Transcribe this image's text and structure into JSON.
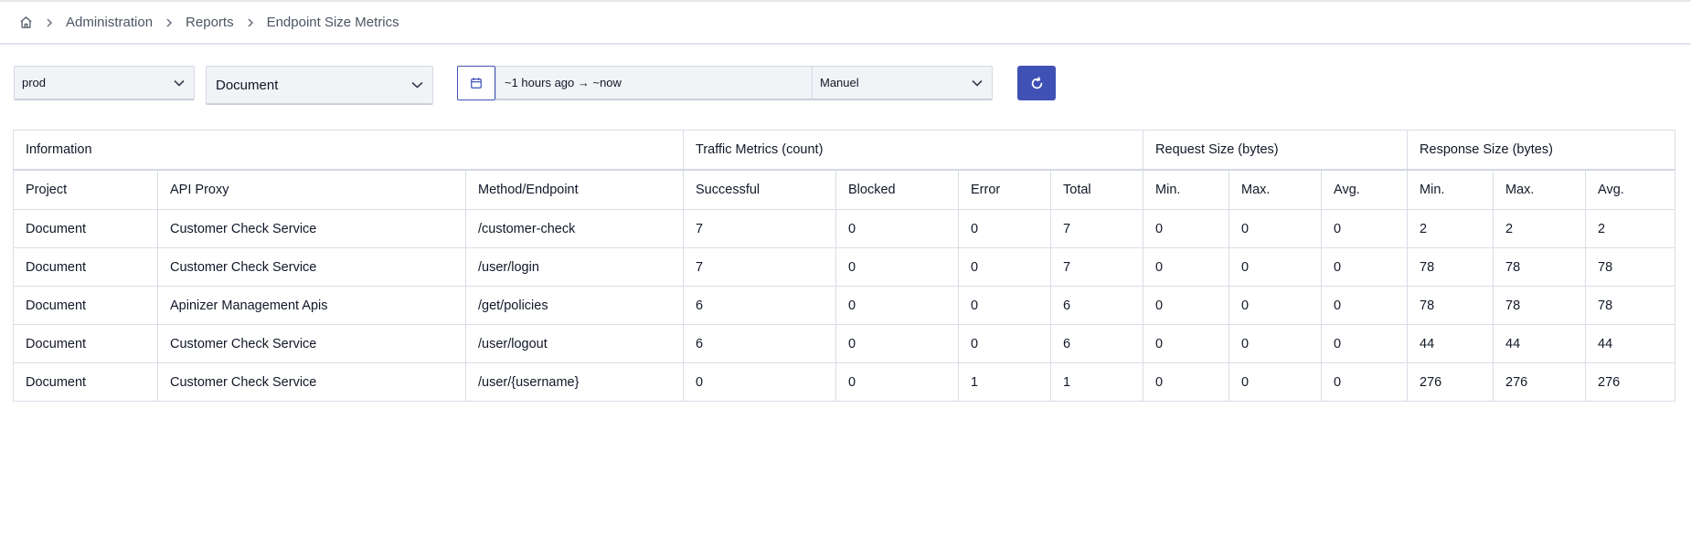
{
  "breadcrumb": {
    "home_icon": "home-icon",
    "items": [
      "Administration",
      "Reports"
    ],
    "current": "Endpoint Size Metrics"
  },
  "filters": {
    "environment": "prod",
    "project": "Document",
    "date_range": "~1 hours ago → ~now",
    "refresh_mode": "Manuel",
    "accent_color": "#3f51b5"
  },
  "table": {
    "groups": [
      "Information",
      "Traffic Metrics (count)",
      "Request Size (bytes)",
      "Response Size (bytes)"
    ],
    "columns": [
      "Project",
      "API Proxy",
      "Method/Endpoint",
      "Successful",
      "Blocked",
      "Error",
      "Total",
      "Min.",
      "Max.",
      "Avg.",
      "Min.",
      "Max.",
      "Avg."
    ],
    "rows": [
      [
        "Document",
        "Customer Check Service",
        "/customer-check",
        "7",
        "0",
        "0",
        "7",
        "0",
        "0",
        "0",
        "2",
        "2",
        "2"
      ],
      [
        "Document",
        "Customer Check Service",
        "/user/login",
        "7",
        "0",
        "0",
        "7",
        "0",
        "0",
        "0",
        "78",
        "78",
        "78"
      ],
      [
        "Document",
        "Apinizer Management Apis",
        "/get/policies",
        "6",
        "0",
        "0",
        "6",
        "0",
        "0",
        "0",
        "78",
        "78",
        "78"
      ],
      [
        "Document",
        "Customer Check Service",
        "/user/logout",
        "6",
        "0",
        "0",
        "6",
        "0",
        "0",
        "0",
        "44",
        "44",
        "44"
      ],
      [
        "Document",
        "Customer Check Service",
        "/user/{username}",
        "0",
        "0",
        "1",
        "1",
        "0",
        "0",
        "0",
        "276",
        "276",
        "276"
      ]
    ]
  }
}
